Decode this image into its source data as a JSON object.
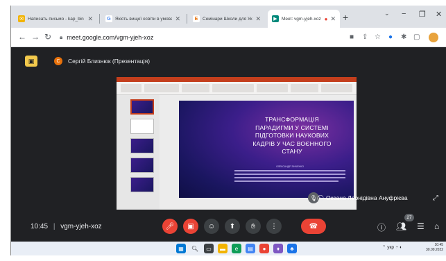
{
  "browser": {
    "tabs": [
      {
        "title": "Написать письмо - kap_bin",
        "favicon": "mail-icon",
        "color": "#f2b300",
        "active": false
      },
      {
        "title": "Якість вищої освіти в умовах",
        "favicon": "google-icon",
        "color": "#4285f4",
        "active": false
      },
      {
        "title": "Семінари Школи для Укр.",
        "favicon": "e-icon",
        "color": "#e8710a",
        "active": false
      },
      {
        "title": "Meet: vgm-yjeh-xoz",
        "favicon": "meet-icon",
        "color": "#00897b",
        "active": true
      }
    ],
    "recording_dot": "●",
    "new_tab": "+",
    "controls": {
      "minimize": "−",
      "maximize": "❐",
      "close": "✕"
    },
    "url": "meet.google.com/vgm-yjeh-xoz"
  },
  "meet": {
    "presenter_label": "Сергій Близнюк (Презентація)",
    "presenter_initial": "С",
    "participant_name": "Оксана Леонідівна Ануфрієва",
    "meeting_time": "10:45",
    "meeting_code": "vgm-yjeh-xoz",
    "participant_count": "27",
    "accent": "#ea4335"
  },
  "slide": {
    "title": "ТРАНСФОРМАЦІЯ\nПАРАДИГМИ У СИСТЕМІ\nПІДГОТОВКИ НАУКОВИХ\nКАДРІВ У ЧАС ВОЄННОГО\nСТАНУ",
    "author": "ОЛЕКСАНДР ЗІНЧЕНКО"
  },
  "taskbar": {
    "tray": "укр",
    "time": "10:45",
    "date": "30.09.2022"
  }
}
